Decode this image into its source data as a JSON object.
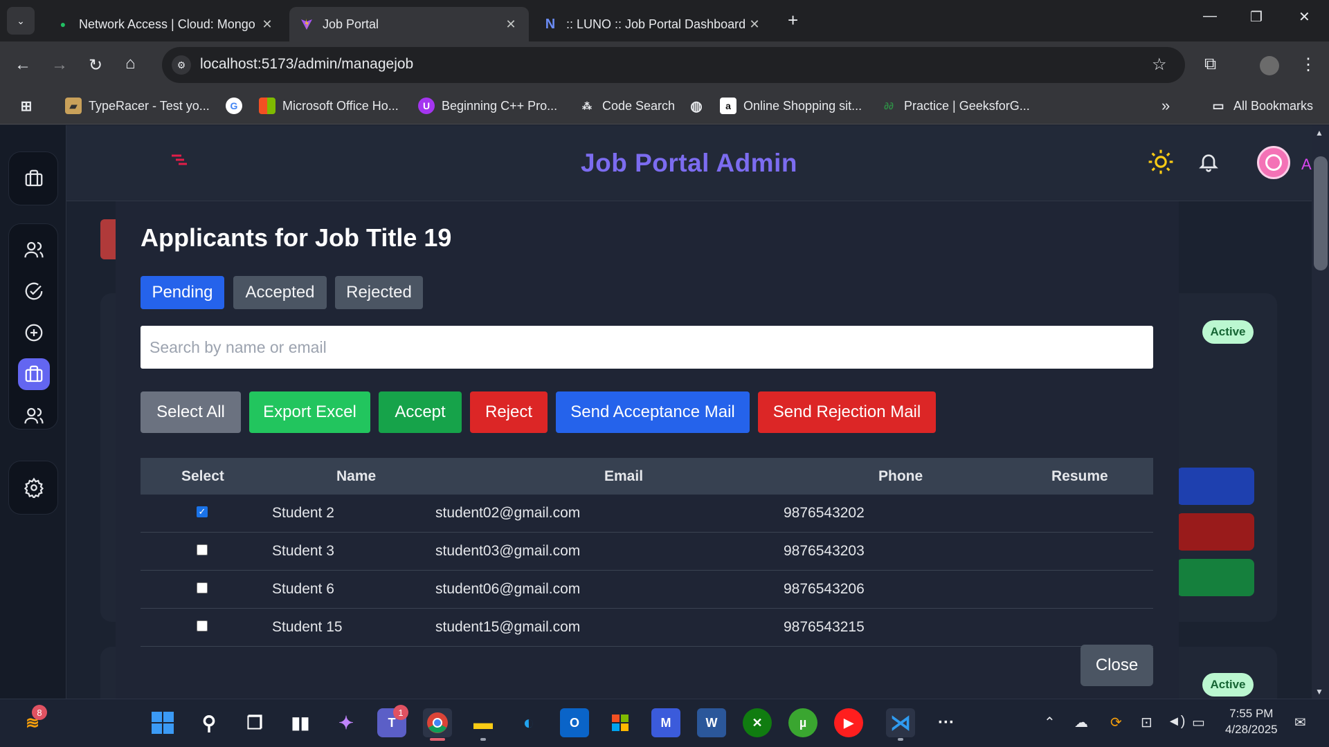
{
  "browser": {
    "tabs": [
      {
        "label": "Network Access | Cloud: Mongo",
        "favicon": "leaf-icon"
      },
      {
        "label": "Job Portal",
        "favicon": "vite-icon"
      },
      {
        "label": ":: LUNO :: Job Portal Dashboard",
        "favicon": "n-icon"
      }
    ],
    "url": "localhost:5173/admin/managejob",
    "bookmarks": [
      {
        "label": "TypeRacer - Test yo..."
      },
      {
        "label": ""
      },
      {
        "label": "Microsoft Office Ho..."
      },
      {
        "label": "Beginning C++ Pro..."
      },
      {
        "label": "Code Search"
      },
      {
        "label": ""
      },
      {
        "label": "Online Shopping sit..."
      },
      {
        "label": "Practice | GeeksforG..."
      }
    ],
    "all_bookmarks": "All Bookmarks"
  },
  "header": {
    "brand": "Job Portal Admin",
    "user_label": "Admin"
  },
  "background": {
    "status_badges": [
      "Active",
      "Active"
    ]
  },
  "modal": {
    "title": "Applicants for Job Title 19",
    "tabs": [
      "Pending",
      "Accepted",
      "Rejected"
    ],
    "active_tab": "Pending",
    "search_placeholder": "Search by name or email",
    "actions": {
      "select_all": "Select All",
      "export_excel": "Export Excel",
      "accept": "Accept",
      "reject": "Reject",
      "send_acceptance": "Send Acceptance Mail",
      "send_rejection": "Send Rejection Mail"
    },
    "columns": [
      "Select",
      "Name",
      "Email",
      "Phone",
      "Resume"
    ],
    "rows": [
      {
        "selected": true,
        "name": "Student 2",
        "email": "student02@gmail.com",
        "phone": "9876543202",
        "resume": ""
      },
      {
        "selected": false,
        "name": "Student 3",
        "email": "student03@gmail.com",
        "phone": "9876543203",
        "resume": ""
      },
      {
        "selected": false,
        "name": "Student 6",
        "email": "student06@gmail.com",
        "phone": "9876543206",
        "resume": ""
      },
      {
        "selected": false,
        "name": "Student 15",
        "email": "student15@gmail.com",
        "phone": "9876543215",
        "resume": ""
      }
    ],
    "close_label": "Close"
  },
  "taskbar": {
    "widget_badge": "8",
    "teams_badge": "1",
    "time": "7:55 PM",
    "date": "4/28/2025"
  },
  "colors": {
    "primary": "#2563eb",
    "success": "#22c55e",
    "success_dark": "#16a34a",
    "danger": "#dc2626",
    "neutral": "#6b7280",
    "brand": "#7c6cf0"
  }
}
